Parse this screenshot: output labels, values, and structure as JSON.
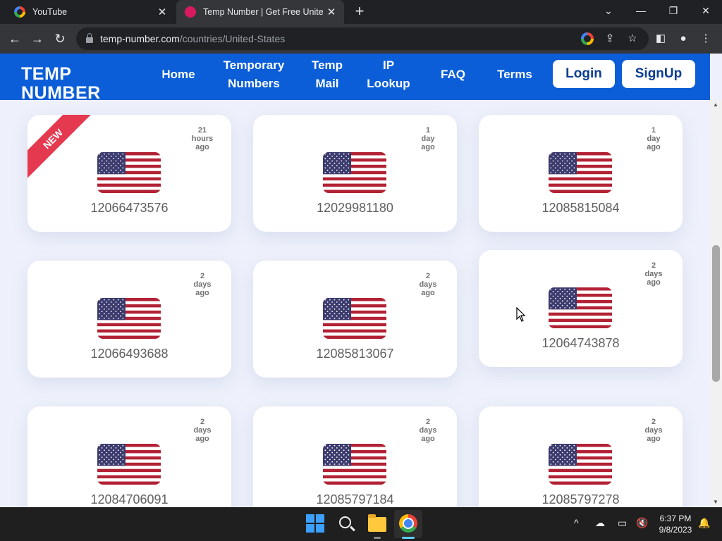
{
  "browser": {
    "tabs": [
      {
        "title": "YouTube",
        "close": "✕"
      },
      {
        "title": "Temp Number | Get Free United S",
        "close": "✕"
      }
    ],
    "new_tab": "+",
    "window_controls": {
      "minimize": "—",
      "restore": "❐",
      "close": "✕",
      "tab_search": "⌄"
    },
    "url": {
      "host": "temp-number.com",
      "path": "/countries/United-States"
    },
    "nav": {
      "back": "←",
      "forward": "→",
      "reload": "↻"
    }
  },
  "site": {
    "logo": "TEMP NUMBER",
    "nav": {
      "home": "Home",
      "temporary_numbers": "Temporary Numbers",
      "temp_mail": "Temp Mail",
      "ip_lookup": "IP Lookup",
      "faq": "FAQ",
      "terms": "Terms"
    },
    "login": "Login",
    "signup": "SignUp",
    "ribbon": "NEW",
    "cards": [
      {
        "number": "12066473576",
        "ago": [
          "21",
          "hours",
          "ago"
        ]
      },
      {
        "number": "12029981180",
        "ago": [
          "1",
          "day",
          "ago"
        ]
      },
      {
        "number": "12085815084",
        "ago": [
          "1",
          "day",
          "ago"
        ]
      },
      {
        "number": "12066493688",
        "ago": [
          "2",
          "days",
          "ago"
        ]
      },
      {
        "number": "12085813067",
        "ago": [
          "2",
          "days",
          "ago"
        ]
      },
      {
        "number": "12064743878",
        "ago": [
          "2",
          "days",
          "ago"
        ]
      },
      {
        "number": "12084706091",
        "ago": [
          "2",
          "days",
          "ago"
        ]
      },
      {
        "number": "12085797184",
        "ago": [
          "2",
          "days",
          "ago"
        ]
      },
      {
        "number": "12085797278",
        "ago": [
          "2",
          "days",
          "ago"
        ]
      }
    ]
  },
  "taskbar": {
    "time": "6:37 PM",
    "date": "9/8/2023",
    "tray_chevron": "^"
  },
  "colors": {
    "site_header": "#0b5ed7",
    "ribbon": "#e53950",
    "page_bg": "#eef1fb"
  }
}
